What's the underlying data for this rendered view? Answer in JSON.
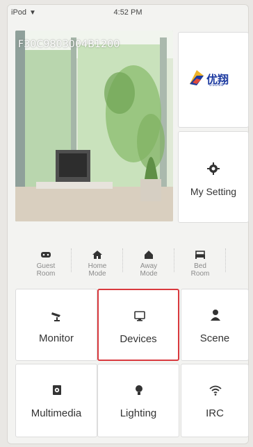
{
  "status_bar": {
    "carrier": "iPod",
    "time": "4:52 PM"
  },
  "hero": {
    "device_id": "F30C9803004B1200"
  },
  "logo": {
    "brand_cn": "优翔",
    "brand_en": "USUNG"
  },
  "my_setting": {
    "label": "My Setting",
    "icon": "gear-icon"
  },
  "modes": [
    {
      "label_line1": "Guest",
      "label_line2": "Room",
      "icon": "guest-room-icon"
    },
    {
      "label_line1": "Home",
      "label_line2": "Mode",
      "icon": "home-icon"
    },
    {
      "label_line1": "Away",
      "label_line2": "Mode",
      "icon": "away-house-icon"
    },
    {
      "label_line1": "Bed",
      "label_line2": "Room",
      "icon": "bed-icon"
    }
  ],
  "grid": [
    {
      "label": "Monitor",
      "icon": "camera-icon"
    },
    {
      "label": "Devices",
      "icon": "monitor-icon",
      "selected": true
    },
    {
      "label": "Scene",
      "icon": "person-icon"
    },
    {
      "label": "Multimedia",
      "icon": "speaker-icon"
    },
    {
      "label": "Lighting",
      "icon": "bulb-icon"
    },
    {
      "label": "IRC",
      "icon": "wifi-icon"
    }
  ],
  "colors": {
    "highlight": "#d9393e",
    "brand_blue": "#1c3aa0"
  }
}
